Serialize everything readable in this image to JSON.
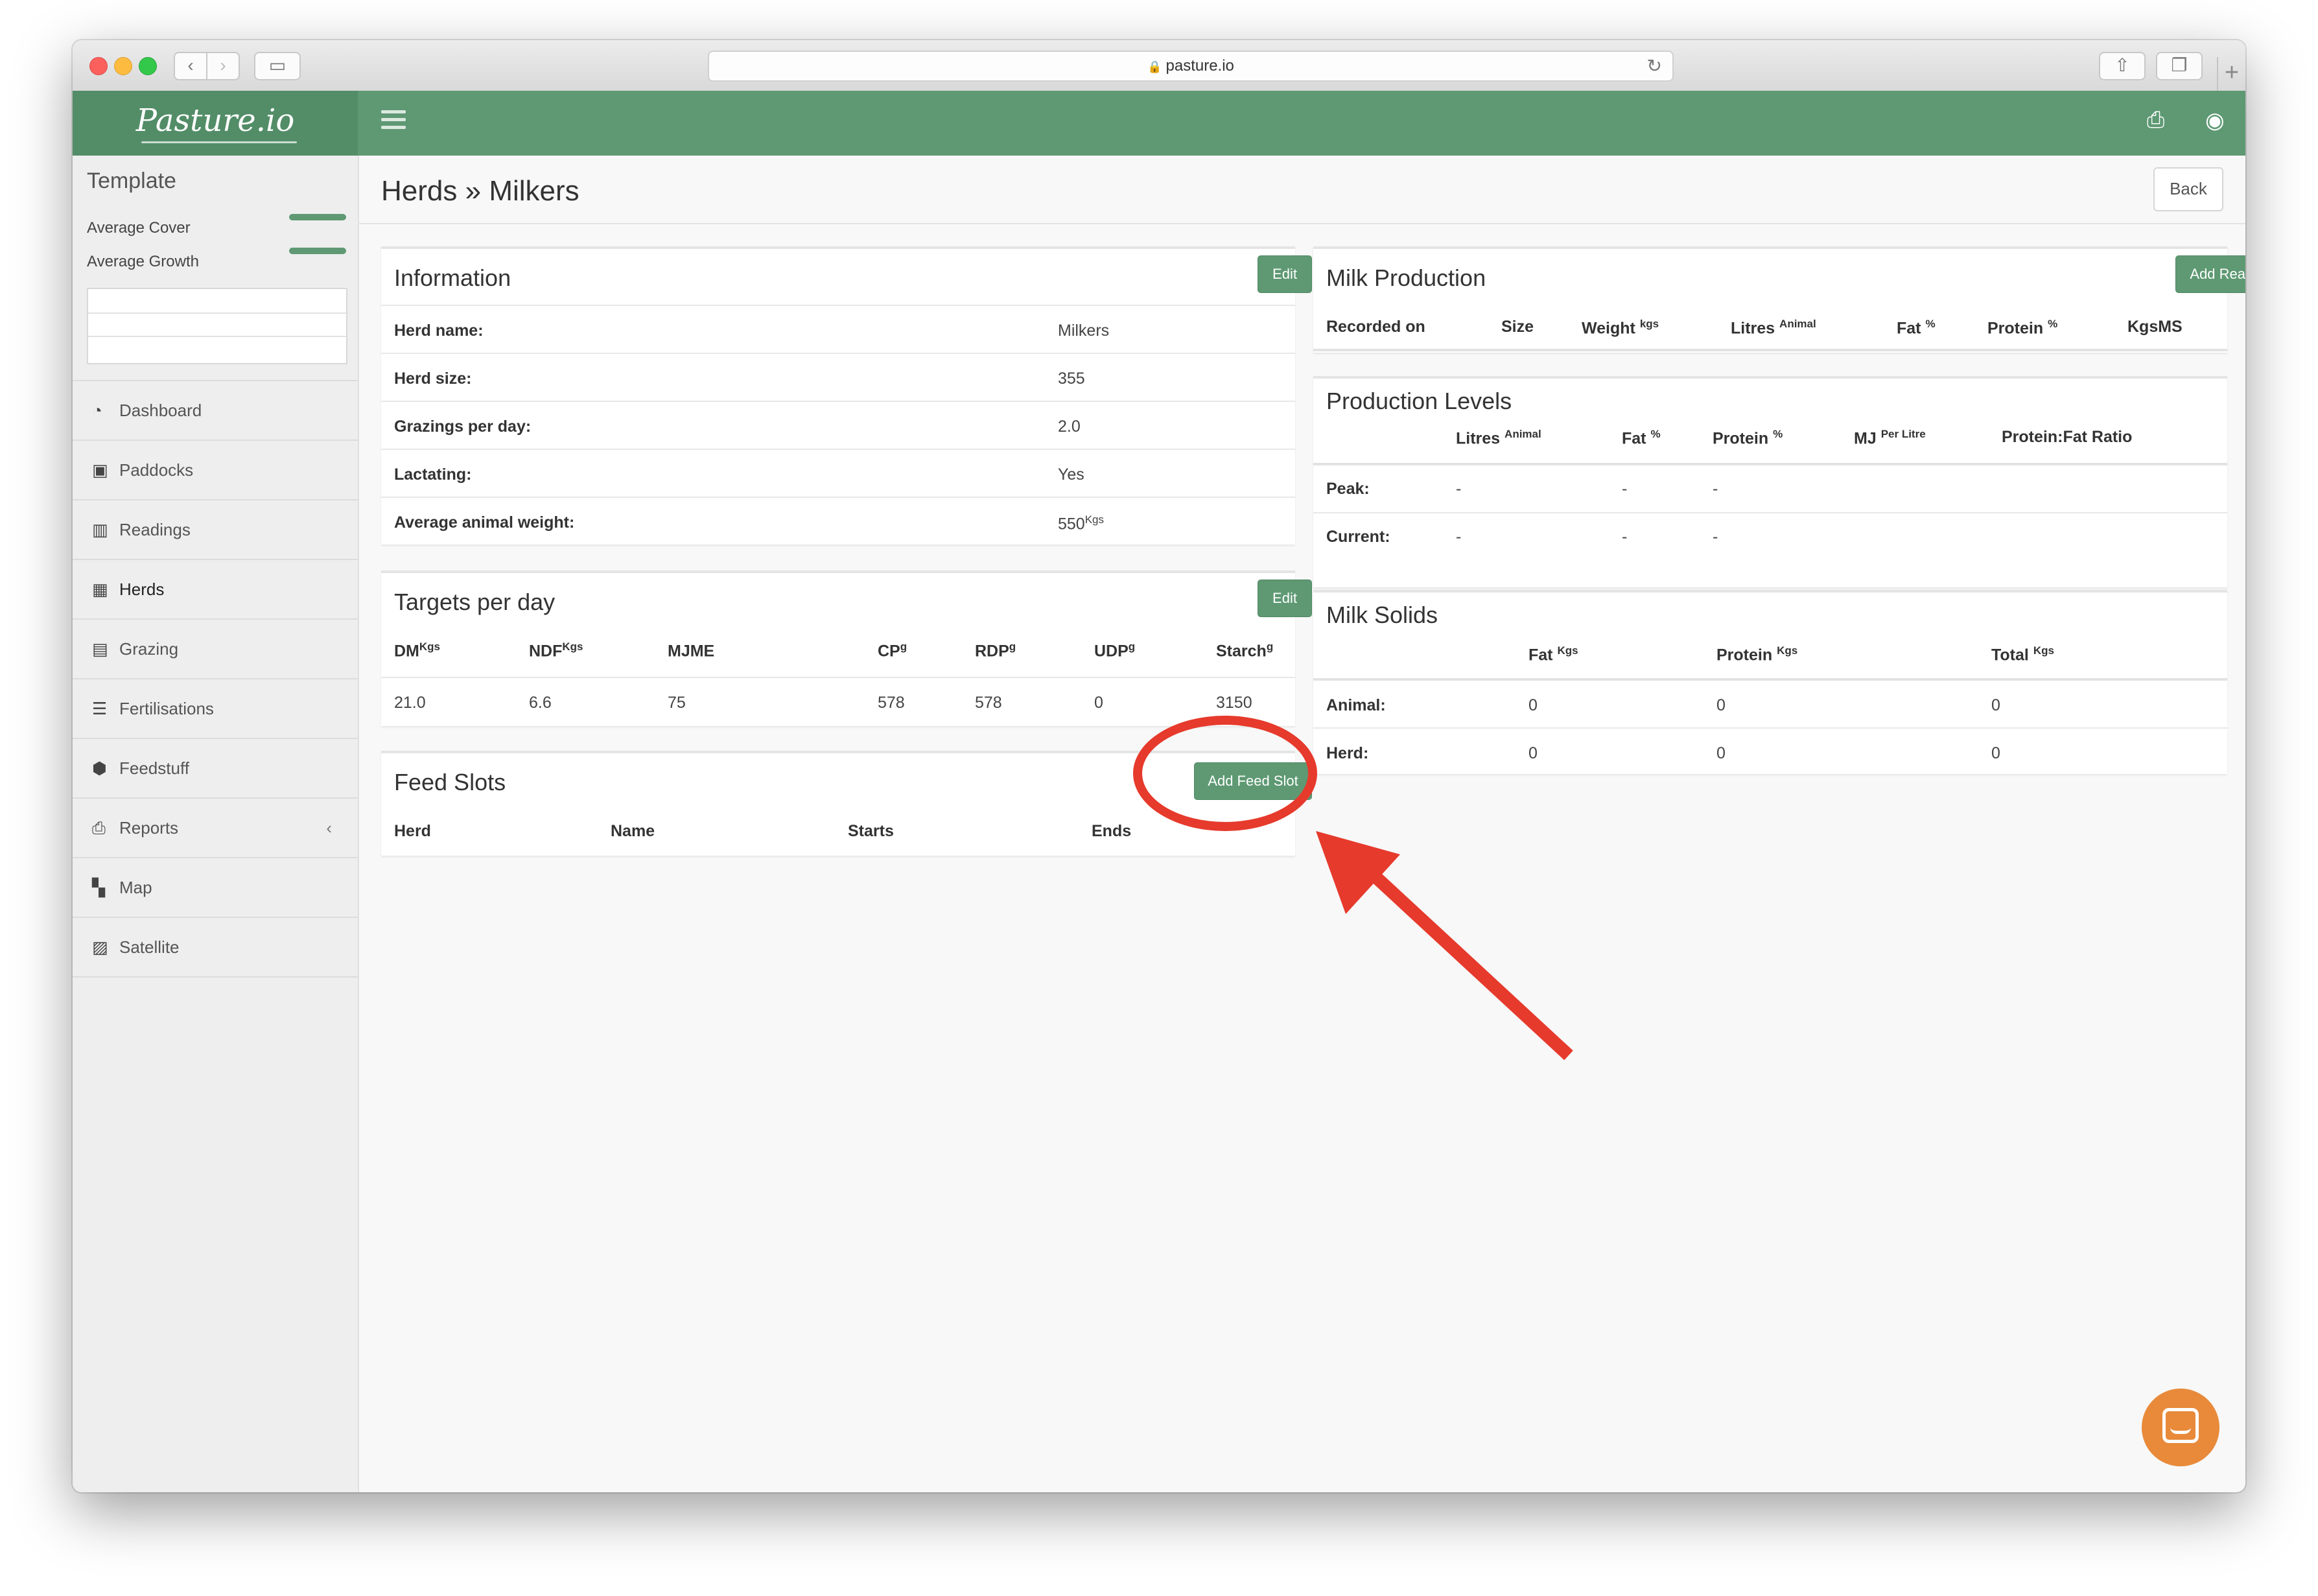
{
  "browser": {
    "url": "pasture.io"
  },
  "app": {
    "brand": "Pasture.io"
  },
  "sidebar": {
    "template_title": "Template",
    "average_cover": "Average Cover",
    "average_growth": "Average Growth",
    "menu": [
      {
        "label": "Dashboard",
        "icon": "dashboard-icon"
      },
      {
        "label": "Paddocks",
        "icon": "paddocks-icon"
      },
      {
        "label": "Readings",
        "icon": "chart-icon"
      },
      {
        "label": "Herds",
        "icon": "grid-icon"
      },
      {
        "label": "Grazing",
        "icon": "calendar-icon"
      },
      {
        "label": "Fertilisations",
        "icon": "list-icon"
      },
      {
        "label": "Feedstuff",
        "icon": "cubes-icon"
      },
      {
        "label": "Reports",
        "icon": "print-icon"
      },
      {
        "label": "Map",
        "icon": "map-icon"
      },
      {
        "label": "Satellite",
        "icon": "image-icon"
      }
    ]
  },
  "page": {
    "crumb_1": "Herds",
    "crumb_sep": "»",
    "crumb_2": "Milkers",
    "back_label": "Back"
  },
  "information": {
    "title": "Information",
    "edit_label": "Edit",
    "rows": [
      {
        "label": "Herd name:",
        "value": "Milkers"
      },
      {
        "label": "Herd size:",
        "value": "355"
      },
      {
        "label": "Grazings per day:",
        "value": "2.0"
      },
      {
        "label": "Lactating:",
        "value": "Yes"
      },
      {
        "label": "Average animal weight:",
        "value": "550",
        "unit": "Kgs"
      }
    ]
  },
  "targets": {
    "title": "Targets per day",
    "edit_label": "Edit",
    "headers": [
      {
        "name": "DM",
        "unit": "Kgs"
      },
      {
        "name": "NDF",
        "unit": "Kgs"
      },
      {
        "name": "MJME",
        "unit": ""
      },
      {
        "name": "CP",
        "unit": "g"
      },
      {
        "name": "RDP",
        "unit": "g"
      },
      {
        "name": "UDP",
        "unit": "g"
      },
      {
        "name": "Starch",
        "unit": "g"
      }
    ],
    "values": [
      "21.0",
      "6.6",
      "75",
      "578",
      "578",
      "0",
      "3150"
    ]
  },
  "feed_slots": {
    "title": "Feed Slots",
    "add_label": "Add Feed Slot",
    "headers": [
      "Herd",
      "Name",
      "Starts",
      "Ends"
    ]
  },
  "milk_production": {
    "title": "Milk Production",
    "add_label": "Add Reading",
    "headers": [
      {
        "name": "Recorded on",
        "unit": ""
      },
      {
        "name": "Size",
        "unit": ""
      },
      {
        "name": "Weight",
        "unit": "kgs"
      },
      {
        "name": "Litres",
        "unit": "Animal"
      },
      {
        "name": "Fat",
        "unit": "%"
      },
      {
        "name": "Protein",
        "unit": "%"
      },
      {
        "name": "KgsMS",
        "unit": ""
      }
    ]
  },
  "production_levels": {
    "title": "Production Levels",
    "headers": [
      {
        "name": "Litres",
        "unit": "Animal"
      },
      {
        "name": "Fat",
        "unit": "%"
      },
      {
        "name": "Protein",
        "unit": "%"
      },
      {
        "name": "MJ",
        "unit": "Per Litre"
      },
      {
        "name": "Protein:Fat Ratio",
        "unit": ""
      }
    ],
    "rows": [
      {
        "label": "Peak:",
        "values": [
          "-",
          "-",
          "-"
        ]
      },
      {
        "label": "Current:",
        "values": [
          "-",
          "-",
          "-"
        ]
      }
    ]
  },
  "milk_solids": {
    "title": "Milk Solids",
    "headers": [
      {
        "name": "Fat",
        "unit": "Kgs"
      },
      {
        "name": "Protein",
        "unit": "Kgs"
      },
      {
        "name": "Total",
        "unit": "Kgs"
      }
    ],
    "rows": [
      {
        "label": "Animal:",
        "values": [
          "0",
          "0",
          "0"
        ]
      },
      {
        "label": "Herd:",
        "values": [
          "0",
          "0",
          "0"
        ]
      }
    ]
  },
  "colors": {
    "brand_green": "#5e9973",
    "annotation_red": "#e63a2c",
    "chat_orange": "#e88a3a"
  }
}
